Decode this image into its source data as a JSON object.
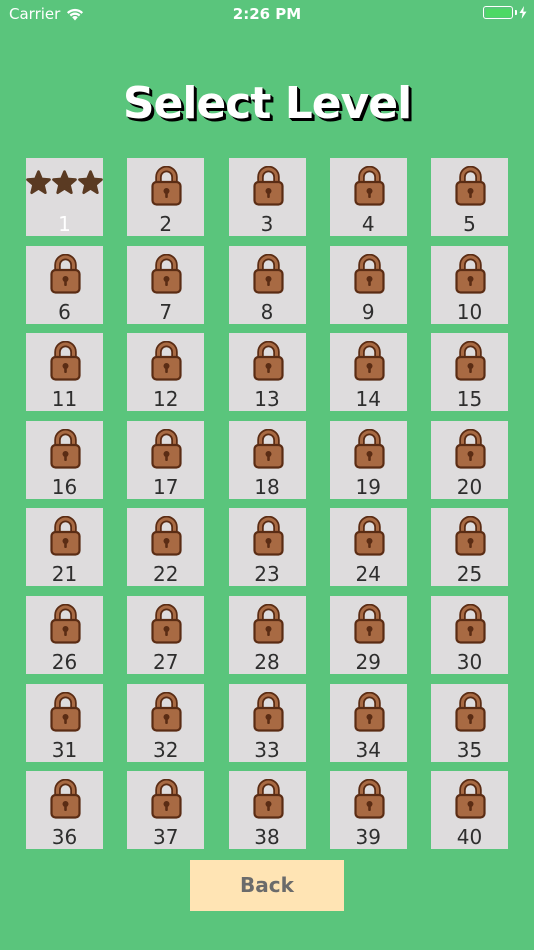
{
  "status_bar": {
    "carrier": "Carrier",
    "time": "2:26 PM",
    "battery_color": "#4cd964"
  },
  "header": {
    "title": "Select Level"
  },
  "colors": {
    "background": "#5ac57c",
    "tile": "#dedcdd",
    "lock_fill": "#a86a43",
    "lock_stroke": "#5a2c14",
    "star_fill": "#5a3a22",
    "back_button_bg": "#ffe4b4"
  },
  "levels": [
    {
      "number": "1",
      "locked": false,
      "stars": 3
    },
    {
      "number": "2",
      "locked": true
    },
    {
      "number": "3",
      "locked": true
    },
    {
      "number": "4",
      "locked": true
    },
    {
      "number": "5",
      "locked": true
    },
    {
      "number": "6",
      "locked": true
    },
    {
      "number": "7",
      "locked": true
    },
    {
      "number": "8",
      "locked": true
    },
    {
      "number": "9",
      "locked": true
    },
    {
      "number": "10",
      "locked": true
    },
    {
      "number": "11",
      "locked": true
    },
    {
      "number": "12",
      "locked": true
    },
    {
      "number": "13",
      "locked": true
    },
    {
      "number": "14",
      "locked": true
    },
    {
      "number": "15",
      "locked": true
    },
    {
      "number": "16",
      "locked": true
    },
    {
      "number": "17",
      "locked": true
    },
    {
      "number": "18",
      "locked": true
    },
    {
      "number": "19",
      "locked": true
    },
    {
      "number": "20",
      "locked": true
    },
    {
      "number": "21",
      "locked": true
    },
    {
      "number": "22",
      "locked": true
    },
    {
      "number": "23",
      "locked": true
    },
    {
      "number": "24",
      "locked": true
    },
    {
      "number": "25",
      "locked": true
    },
    {
      "number": "26",
      "locked": true
    },
    {
      "number": "27",
      "locked": true
    },
    {
      "number": "28",
      "locked": true
    },
    {
      "number": "29",
      "locked": true
    },
    {
      "number": "30",
      "locked": true
    },
    {
      "number": "31",
      "locked": true
    },
    {
      "number": "32",
      "locked": true
    },
    {
      "number": "33",
      "locked": true
    },
    {
      "number": "34",
      "locked": true
    },
    {
      "number": "35",
      "locked": true
    },
    {
      "number": "36",
      "locked": true
    },
    {
      "number": "37",
      "locked": true
    },
    {
      "number": "38",
      "locked": true
    },
    {
      "number": "39",
      "locked": true
    },
    {
      "number": "40",
      "locked": true
    }
  ],
  "back_button": {
    "label": "Back"
  }
}
